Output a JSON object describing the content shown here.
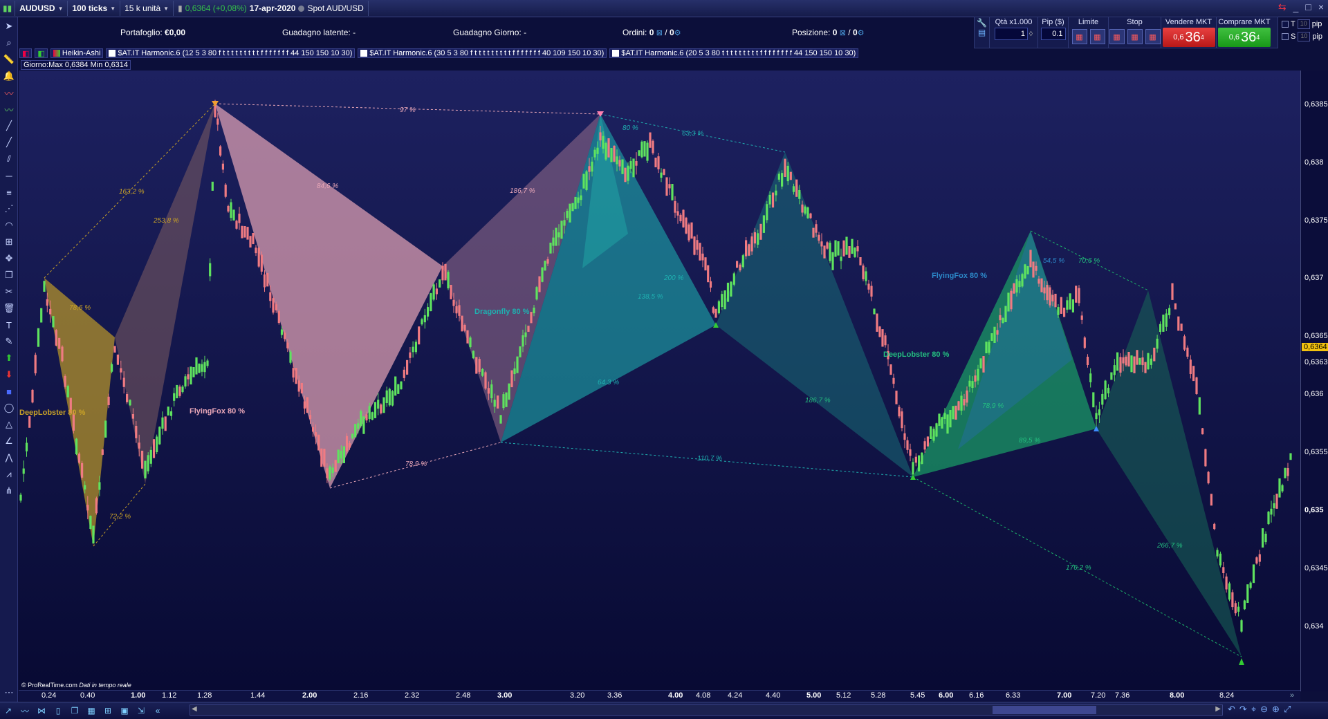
{
  "topbar": {
    "symbol": "AUDUSD",
    "ticks": "100 ticks",
    "units": "15 k unità",
    "price_change": "0,6364 (+0,08%)",
    "date": "17-apr-2020",
    "market": "Spot AUD/USD"
  },
  "infobar": {
    "portfolio_label": "Portafoglio:",
    "portfolio_value": "€0,00",
    "latent_label": "Guadagno latente:",
    "latent_value": "-",
    "day_gain_label": "Guadagno Giorno:",
    "day_gain_value": "-",
    "orders_label": "Ordini:",
    "orders_value": "0",
    "orders_value2": "0",
    "position_label": "Posizione:",
    "position_value": "0",
    "position_value2": "0"
  },
  "order_panel": {
    "qty_label": "Qtà x1.000",
    "qty_value": "1",
    "pip_label": "Pip ($)",
    "pip_value": "0.1",
    "limit_label": "Limite",
    "stop_label": "Stop",
    "sell_label": "Vendere MKT",
    "sell_small": "0,6",
    "sell_big": "36",
    "sell_sup": "4",
    "buy_label": "Comprare MKT",
    "buy_small": "0,6",
    "buy_big": "36",
    "buy_sup": "4",
    "t_label": "T",
    "s_label": "S",
    "pip_word": "pip",
    "pip_box": "10"
  },
  "indicators": {
    "heikin": "Heikin-Ashi",
    "ind1": "$AT.IT Harmonic.6 (12 5 3 80 f t t t t t t t t t f f f f f f f 44 150 150 10 30)",
    "ind2": "$AT.IT Harmonic.6 (30 5 3 80 f t t t t t t t t t f f f f f f f 40 109 150 10 30)",
    "ind3": "$AT.IT Harmonic.6 (20 5 3 80 t t t t t t t t t f f f f f f f f 44 150 150 10 30)",
    "day_range": "Giorno:Max 0,6384 Min 0,6314"
  },
  "price_axis": {
    "labels": [
      "0,6385",
      "0,638",
      "0,6375",
      "0,637",
      "0,6365",
      "0,6363",
      "0,636",
      "0,6355",
      "0,635",
      "0,6345",
      "0,634"
    ],
    "current": "0,6364"
  },
  "time_axis": {
    "labels": [
      "0.24",
      "0.40",
      "1.00",
      "1.12",
      "1.28",
      "1.44",
      "2.00",
      "2.16",
      "2.32",
      "2.48",
      "3.00",
      "3.20",
      "3.36",
      "4.00",
      "4.08",
      "4.24",
      "4.40",
      "5.00",
      "5.12",
      "5.28",
      "5.45",
      "6.00",
      "6.16",
      "6.33",
      "7.00",
      "7.20",
      "7.36",
      "8.00",
      "8.24"
    ]
  },
  "patterns": {
    "deep_lobster_left": "DeepLobster 80 %",
    "flying_fox_1": "FlyingFox 80 %",
    "dragonfly": "Dragonfly 80 %",
    "deep_lobster_2": "DeepLobster 80 %",
    "flying_fox_2": "FlyingFox 80 %",
    "r1": "163,2 %",
    "r2": "253,8 %",
    "r3": "78,6 %",
    "r4": "72,2 %",
    "r5": "97 %",
    "r6": "84,6 %",
    "r7": "186,7 %",
    "r8": "78,9 %",
    "r9": "80 %",
    "r10": "63,3 %",
    "r11": "200 %",
    "r12": "138,5 %",
    "r13": "64,3 %",
    "r14": "110,7 %",
    "r15": "186,7 %",
    "r16": "54,5 %",
    "r17": "70,6 %",
    "r18": "266,7 %",
    "r19": "176,2 %",
    "r20": "89,5 %",
    "r21": "78,9 %"
  },
  "footer": {
    "copyright": "© ProRealTime.com",
    "realtime": "Dati in tempo reale"
  },
  "colors": {
    "background": "#0c0f3a",
    "bull": "#5fe35f",
    "bear": "#f07b82",
    "gold": "#c9a227",
    "pink": "#e8a6b7",
    "mauve": "#9a6f8c",
    "teal": "#1fb0b0",
    "deepteal": "#1a6f77",
    "green": "#1db36a",
    "bluepat": "#2c88c8"
  }
}
